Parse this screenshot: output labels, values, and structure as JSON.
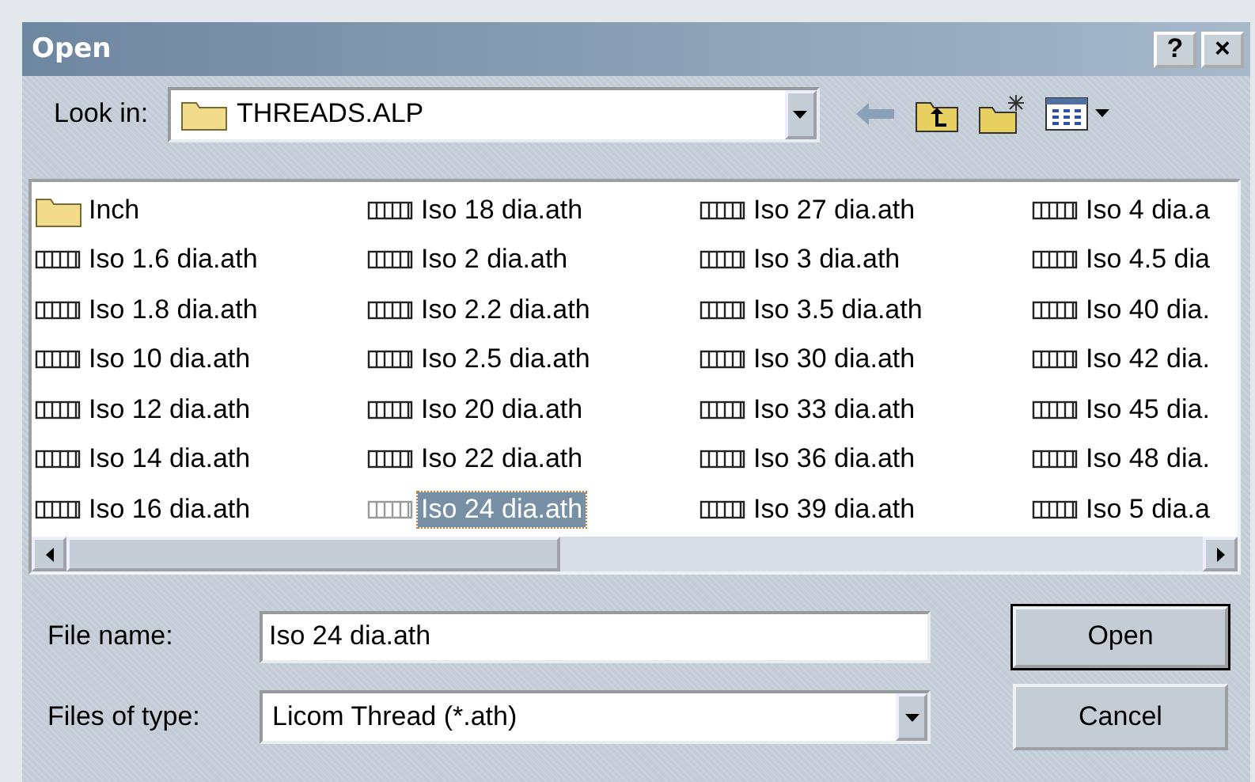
{
  "window": {
    "title": "Open",
    "title_buttons": [
      "?",
      "×"
    ]
  },
  "look_in": {
    "label": "Look in:",
    "value": "THREADS.ALP"
  },
  "files": [
    {
      "kind": "folder",
      "name": "Inch",
      "selected": false
    },
    {
      "kind": "file",
      "name": "Iso 1.6 dia.ath",
      "selected": false
    },
    {
      "kind": "file",
      "name": "Iso 1.8 dia.ath",
      "selected": false
    },
    {
      "kind": "file",
      "name": "Iso 10 dia.ath",
      "selected": false
    },
    {
      "kind": "file",
      "name": "Iso 12 dia.ath",
      "selected": false
    },
    {
      "kind": "file",
      "name": "Iso 14 dia.ath",
      "selected": false
    },
    {
      "kind": "file",
      "name": "Iso 16 dia.ath",
      "selected": false
    },
    {
      "kind": "file",
      "name": "Iso 18 dia.ath",
      "selected": false
    },
    {
      "kind": "file",
      "name": "Iso 2 dia.ath",
      "selected": false
    },
    {
      "kind": "file",
      "name": "Iso 2.2 dia.ath",
      "selected": false
    },
    {
      "kind": "file",
      "name": "Iso 2.5 dia.ath",
      "selected": false
    },
    {
      "kind": "file",
      "name": "Iso 20 dia.ath",
      "selected": false
    },
    {
      "kind": "file",
      "name": "Iso 22 dia.ath",
      "selected": false
    },
    {
      "kind": "file",
      "name": "Iso 24 dia.ath",
      "selected": true
    },
    {
      "kind": "file",
      "name": "Iso 27 dia.ath",
      "selected": false
    },
    {
      "kind": "file",
      "name": "Iso 3 dia.ath",
      "selected": false
    },
    {
      "kind": "file",
      "name": "Iso 3.5 dia.ath",
      "selected": false
    },
    {
      "kind": "file",
      "name": "Iso 30 dia.ath",
      "selected": false
    },
    {
      "kind": "file",
      "name": "Iso 33 dia.ath",
      "selected": false
    },
    {
      "kind": "file",
      "name": "Iso 36 dia.ath",
      "selected": false
    },
    {
      "kind": "file",
      "name": "Iso 39 dia.ath",
      "selected": false
    },
    {
      "kind": "file",
      "name": "Iso 4 dia.a",
      "selected": false
    },
    {
      "kind": "file",
      "name": "Iso 4.5 dia",
      "selected": false
    },
    {
      "kind": "file",
      "name": "Iso 40 dia.",
      "selected": false
    },
    {
      "kind": "file",
      "name": "Iso 42 dia.",
      "selected": false
    },
    {
      "kind": "file",
      "name": "Iso 45 dia.",
      "selected": false
    },
    {
      "kind": "file",
      "name": "Iso 48 dia.",
      "selected": false
    },
    {
      "kind": "file",
      "name": "Iso 5 dia.a",
      "selected": false
    }
  ],
  "file_name": {
    "label": "File name:",
    "value": "Iso 24 dia.ath"
  },
  "file_type": {
    "label": "Files of type:",
    "value": "Licom Thread (*.ath)"
  },
  "buttons": [
    {
      "label": "Open",
      "default": true
    },
    {
      "label": "Cancel",
      "default": false
    }
  ]
}
